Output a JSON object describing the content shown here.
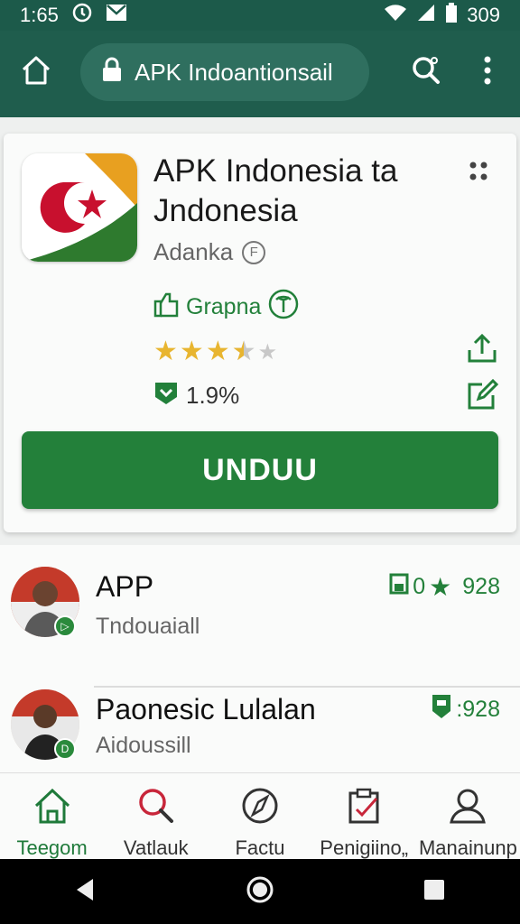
{
  "status_bar": {
    "time": "1:65",
    "battery": "309",
    "icons": [
      "sync-icon",
      "mail-icon",
      "wifi-icon",
      "signal-icon",
      "battery-icon"
    ]
  },
  "app_bar": {
    "search_text": "APK Indoantionsail",
    "icons": [
      "home-icon",
      "lock-icon",
      "search-icon",
      "more-vert-icon"
    ]
  },
  "app_card": {
    "title": "APK Indonesia ta Jndonesia",
    "developer": "Adanka",
    "developer_info_glyph": "F",
    "category": "Grapna",
    "rating": 3.5,
    "downloads": "1.9%",
    "download_label": "UNDUU"
  },
  "list": {
    "items": [
      {
        "title": "APP",
        "subtitle": "Tndouaiall",
        "count": "928",
        "count_prefix": "0"
      },
      {
        "title": "Paonesic Lulalan",
        "subtitle": "Aidoussill",
        "count": ":928"
      }
    ]
  },
  "bottom_nav": {
    "items": [
      {
        "label": "Teegom",
        "icon": "home-icon"
      },
      {
        "label": "Vatlauk",
        "icon": "search-icon"
      },
      {
        "label": "Factu",
        "icon": "compass-icon"
      },
      {
        "label": "Penigiino„",
        "icon": "clipboard-icon"
      },
      {
        "label": "Manainunp",
        "icon": "user-icon"
      }
    ]
  },
  "colors": {
    "app_bar": "#1f5d4d",
    "accent": "#23803a",
    "star": "#e8b530"
  }
}
